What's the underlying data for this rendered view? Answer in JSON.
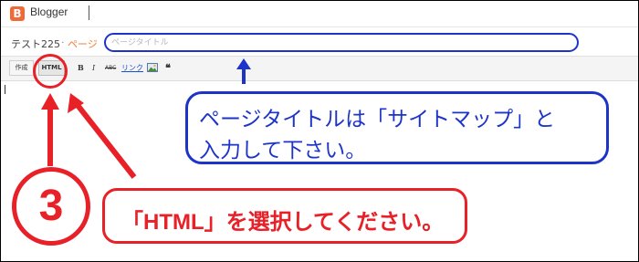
{
  "app": {
    "name": "Blogger",
    "logo_letter": "B"
  },
  "title_row": {
    "blog_name": "テスト225",
    "separator": "·",
    "page_label": "ページ",
    "title_placeholder": "ページタイトル"
  },
  "toolbar": {
    "compose_label": "作成",
    "html_label": "HTML",
    "bold_label": "B",
    "italic_label": "I",
    "strike_label": "ABC",
    "link_label": "リンク",
    "image_icon": "image-icon",
    "quote_label": "❝"
  },
  "annotations": {
    "blue_line1": "ページタイトルは「サイトマップ」と",
    "blue_line2": "入力して下さい。",
    "red_instruction": "「HTML」を選択してください。",
    "step_number": "3"
  },
  "colors": {
    "annotation_blue": "#1d34c8",
    "annotation_red": "#e82028",
    "blogger_orange": "#f06a35"
  }
}
